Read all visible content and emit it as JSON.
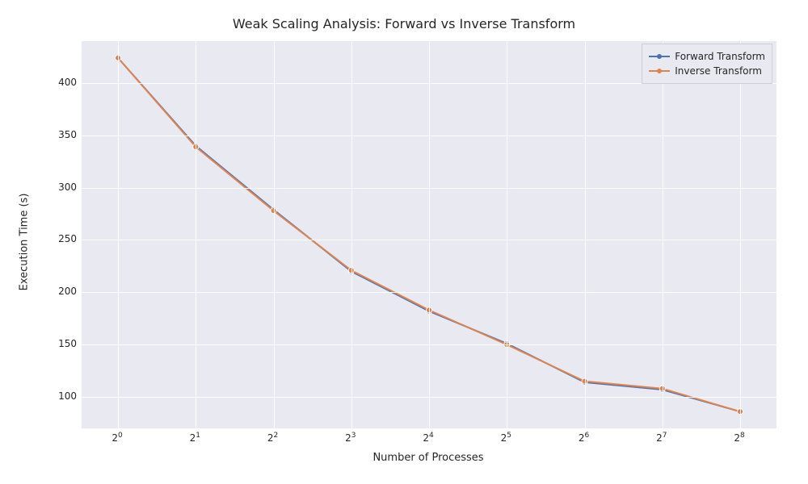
{
  "chart_data": {
    "type": "line",
    "title": "Weak Scaling Analysis: Forward vs Inverse Transform",
    "xlabel": "Number of Processes",
    "ylabel": "Execution Time (s)",
    "x_exponents": [
      0,
      1,
      2,
      3,
      4,
      5,
      6,
      7,
      8
    ],
    "x_tick_labels": [
      "2^0",
      "2^1",
      "2^2",
      "2^3",
      "2^4",
      "2^5",
      "2^6",
      "2^7",
      "2^8"
    ],
    "y_ticks": [
      100,
      150,
      200,
      250,
      300,
      350,
      400
    ],
    "ylim": [
      70,
      440
    ],
    "series": [
      {
        "name": "Forward Transform",
        "color": "#4c72b0",
        "values": [
          424,
          340,
          279,
          220,
          182,
          151,
          114,
          107,
          86
        ]
      },
      {
        "name": "Inverse Transform",
        "color": "#dd8452",
        "values": [
          424,
          339,
          278,
          221,
          183,
          150,
          115,
          108,
          86
        ]
      }
    ]
  },
  "legend": {
    "items": [
      {
        "label": "Forward Transform"
      },
      {
        "label": "Inverse Transform"
      }
    ]
  }
}
